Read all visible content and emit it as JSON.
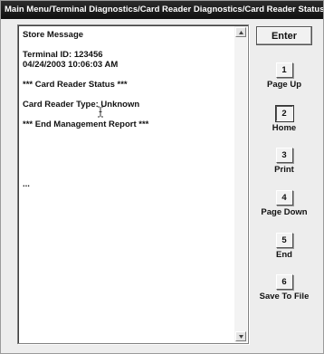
{
  "window": {
    "title": "Main Menu/Terminal Diagnostics/Card Reader Diagnostics/Card Reader Status"
  },
  "report": {
    "lines": [
      "Store Message",
      "",
      "Terminal ID: 123456",
      "04/24/2003 10:06:03 AM",
      "",
      "*** Card Reader Status ***",
      "",
      "Card Reader Type: Unknown",
      "",
      "*** End Management Report ***",
      "",
      "",
      "",
      "",
      "",
      "...",
      "",
      "",
      "",
      ""
    ]
  },
  "buttons": {
    "enter": "Enter",
    "keys": [
      {
        "number": "1",
        "label": "Page Up"
      },
      {
        "number": "2",
        "label": "Home",
        "selected": true
      },
      {
        "number": "3",
        "label": "Print"
      },
      {
        "number": "4",
        "label": "Page Down"
      },
      {
        "number": "5",
        "label": "End"
      },
      {
        "number": "6",
        "label": "Save To File"
      }
    ]
  },
  "icons": {
    "scroll_up": "scroll-up-arrow-icon",
    "scroll_down": "scroll-down-arrow-icon",
    "text_cursor": "text-cursor-icon"
  }
}
